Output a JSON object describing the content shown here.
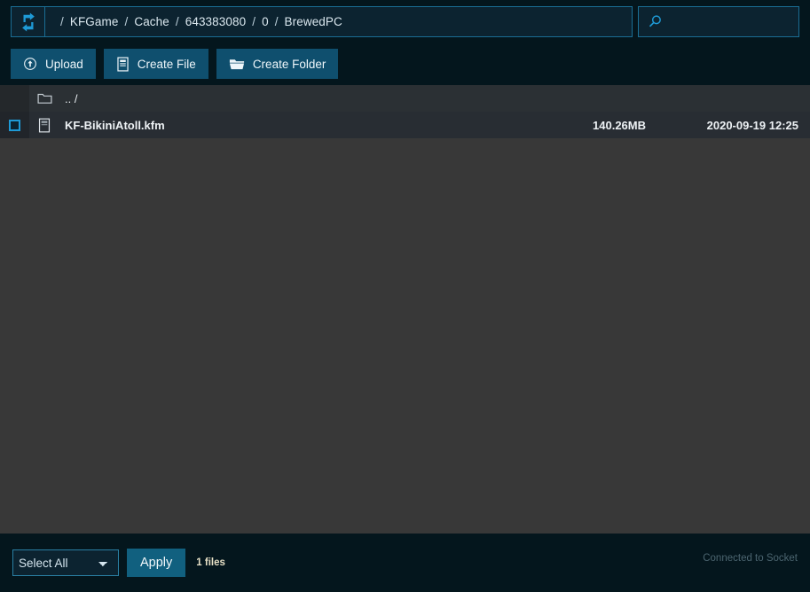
{
  "app": {
    "logo_icon": "sync-arrows-icon",
    "accent_color": "#1e9ad6",
    "button_color": "#0f4f6e",
    "background_color": "#04161d",
    "list_background_color": "#383838"
  },
  "pathbar": {
    "crumbs": [
      "KFGame",
      "Cache",
      "643383080",
      "0",
      "BrewedPC"
    ],
    "separator": "/"
  },
  "search": {
    "icon": "search-icon",
    "value": "",
    "placeholder": ""
  },
  "toolbar": {
    "buttons": [
      {
        "label": "Upload",
        "icon": "upload-circle-icon"
      },
      {
        "label": "Create File",
        "icon": "file-icon"
      },
      {
        "label": "Create Folder",
        "icon": "folder-icon"
      }
    ]
  },
  "filelist": {
    "parent_row": {
      "icon": "folder-icon",
      "name": ".. /"
    },
    "rows": [
      {
        "icon": "file-icon",
        "name": "KF-BikiniAtoll.kfm",
        "size": "140.26MB",
        "modified": "2020-09-19 12:25",
        "checked": false
      }
    ]
  },
  "footer": {
    "select_options": [
      "Select All"
    ],
    "select_value": "Select All",
    "apply_label": "Apply",
    "file_count": "1 files",
    "connection_status": "Connected to Socket"
  }
}
